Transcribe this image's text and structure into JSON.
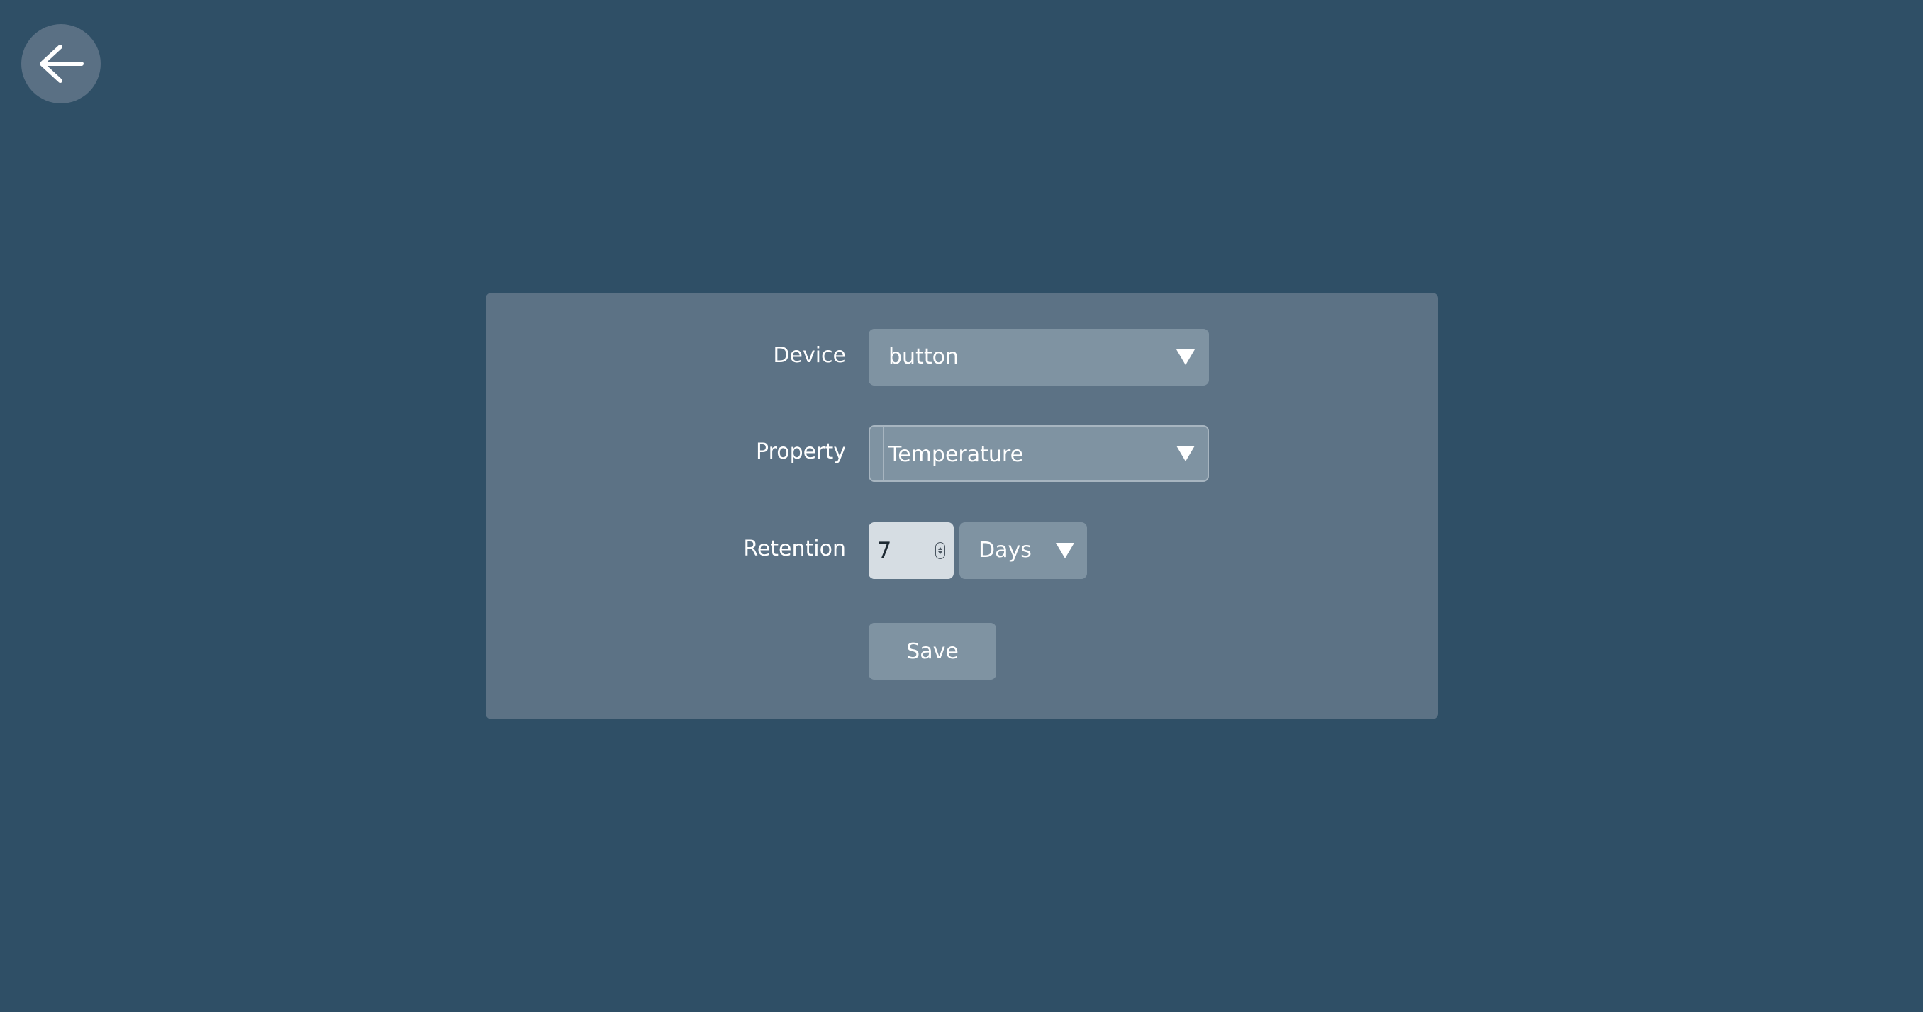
{
  "navigation": {
    "back_icon": "arrow-left-icon"
  },
  "form": {
    "device": {
      "label": "Device",
      "selected": "button"
    },
    "property": {
      "label": "Property",
      "selected": "Temperature"
    },
    "retention": {
      "label": "Retention",
      "value": "7",
      "unit": "Days"
    },
    "save_label": "Save"
  },
  "colors": {
    "background": "#2f4f66",
    "panel": "#5c7285",
    "control": "#7f93a2",
    "input": "#d6dde3"
  }
}
